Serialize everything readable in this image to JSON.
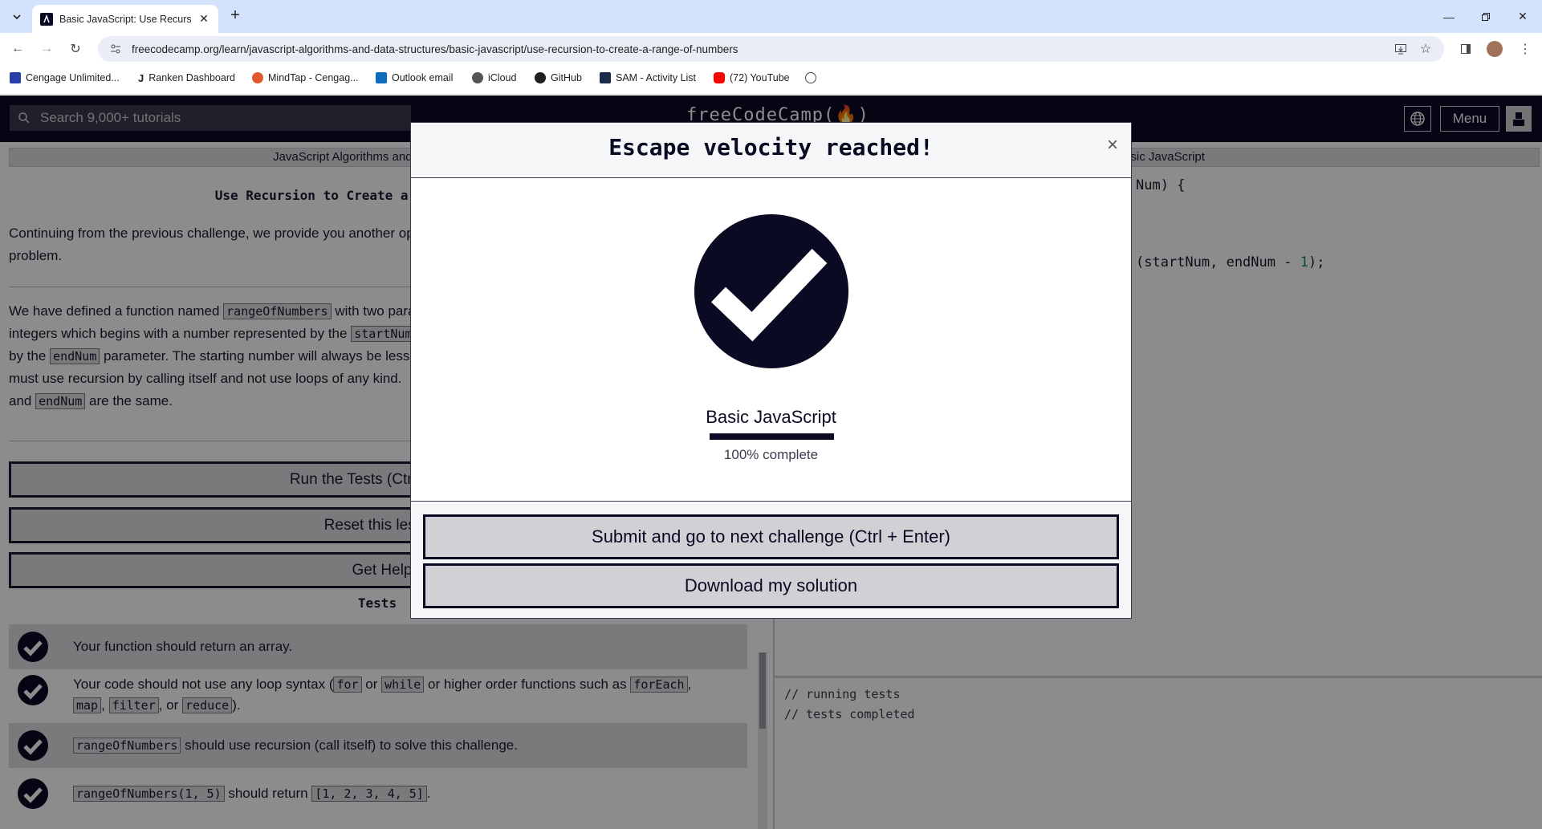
{
  "browser": {
    "tab_title": "Basic JavaScript: Use Recursion",
    "url": "freecodecamp.org/learn/javascript-algorithms-and-data-structures/basic-javascript/use-recursion-to-create-a-range-of-numbers",
    "bookmarks": [
      {
        "label": "Cengage Unlimited...",
        "color": "#2a3ea8"
      },
      {
        "label": "Ranken Dashboard",
        "color": "#ffffff"
      },
      {
        "label": "MindTap - Cengag...",
        "color": "#e05a2b"
      },
      {
        "label": "Outlook email",
        "color": "#0f6cbd"
      },
      {
        "label": "iCloud",
        "color": "#555555"
      },
      {
        "label": "GitHub",
        "color": "#1f1f1f"
      },
      {
        "label": "SAM - Activity List",
        "color": "#1a2b4c"
      },
      {
        "label": "(72) YouTube",
        "color": "#ff0000"
      }
    ]
  },
  "fcc": {
    "search_placeholder": "Search 9,000+ tutorials",
    "logo": "freeCodeCamp(🔥)",
    "menu_label": "Menu"
  },
  "challenge": {
    "breadcrumb": "JavaScript Algorithms and Data Structures",
    "title": "Use Recursion to Create a Range of Numbers",
    "intro_1": "Continuing from the previous challenge, we provide you another opportunity to create a recursive function to solve a",
    "intro_2": "problem.",
    "p1_a": "We have defined a function named",
    "p1_code1": "rangeOfNumbers",
    "p1_b": "with two parameters. The function should return an array of",
    "p2_a": "integers which begins with a number represented by the",
    "p2_code": "startNum",
    "p3_a": "by the",
    "p3_code": "endNum",
    "p3_b": "parameter. The starting number will always be less than or equal to the ending number.",
    "p4_a": "must use recursion by calling itself and not use loops of any kind.",
    "p5_a": "and",
    "p5_code": "endNum",
    "p5_b": "are the same.",
    "run_tests": "Run the Tests (Ctrl + Enter)",
    "reset": "Reset this lesson",
    "get_help": "Get Help",
    "tests_heading": "Tests",
    "tests": [
      {
        "text": "Your function should return an array."
      },
      {
        "a": "Your code should not use any loop syntax (",
        "c1": "for",
        "b": " or ",
        "c2": "while",
        "d": " or higher order functions such as ",
        "c3": "forEach",
        "e": ",",
        "c4": "map",
        "f": ", ",
        "c5": "filter",
        "g": ", or ",
        "c6": "reduce",
        "h": ")."
      },
      {
        "c1": "rangeOfNumbers",
        "a": " should use recursion (call itself) to solve this challenge."
      },
      {
        "c1": "rangeOfNumbers(1, 5)",
        "a": " should return ",
        "c2": "[1, 2, 3, 4, 5]",
        "b": "."
      }
    ]
  },
  "editor": {
    "breadcrumb": "Basic JavaScript",
    "line1": "Num) {",
    "line2_a": "(startNum, endNum - ",
    "line2_num": "1",
    "line2_b": ");",
    "console": [
      "// running tests",
      "// tests completed"
    ]
  },
  "modal": {
    "title": "Escape velocity reached!",
    "close": "×",
    "block_title": "Basic JavaScript",
    "progress_percent": 100,
    "progress_text": "100% complete",
    "submit_button": "Submit and go to next challenge (Ctrl + Enter)",
    "download_button": "Download my solution"
  }
}
